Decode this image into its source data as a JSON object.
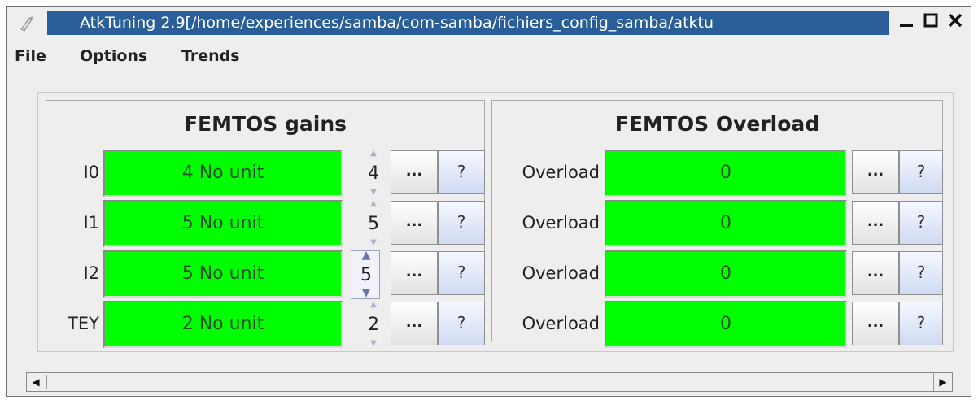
{
  "window": {
    "title": "AtkTuning 2.9[/home/experiences/samba/com-samba/fichiers_config_samba/atktu",
    "controls": {
      "minimize": "—",
      "maximize": "☐",
      "close": "✕"
    }
  },
  "menu": [
    "File",
    "Options",
    "Trends"
  ],
  "gains_panel": {
    "title": "FEMTOS gains",
    "rows": [
      {
        "label": "I0",
        "value": "4 No unit",
        "setpoint": "4",
        "dots": "...",
        "help": "?"
      },
      {
        "label": "I1",
        "value": "5 No unit",
        "setpoint": "5",
        "dots": "...",
        "help": "?"
      },
      {
        "label": "I2",
        "value": "5 No unit",
        "setpoint": "5",
        "dots": "...",
        "help": "?"
      },
      {
        "label": "TEY",
        "value": "2 No unit",
        "setpoint": "2",
        "dots": "...",
        "help": "?"
      }
    ]
  },
  "overload_panel": {
    "title": "FEMTOS Overload",
    "rows": [
      {
        "label": "Overload",
        "value": "0",
        "dots": "...",
        "help": "?"
      },
      {
        "label": "Overload",
        "value": "0",
        "dots": "...",
        "help": "?"
      },
      {
        "label": "Overload",
        "value": "0",
        "dots": "...",
        "help": "?"
      },
      {
        "label": "Overload",
        "value": "0",
        "dots": "...",
        "help": "?"
      }
    ]
  },
  "scrollbar": {
    "left_arrow": "◀",
    "right_arrow": "▶"
  },
  "icons": {
    "spin_up": "▲",
    "spin_down": "▼"
  },
  "colors": {
    "title_bar": "#2a5e99",
    "value_ok": "#00ff00",
    "help_button": "#cfdaf2"
  }
}
